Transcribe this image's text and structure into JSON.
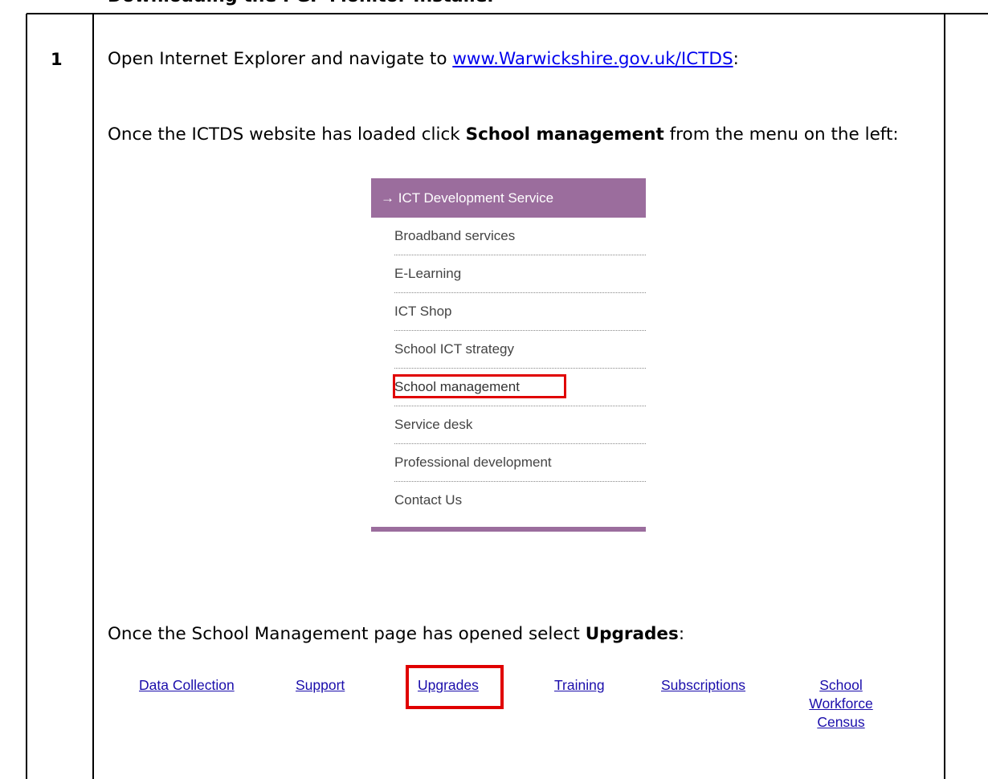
{
  "document": {
    "heading": "Downloading the PGP Monitor Installer",
    "step_number": "1",
    "line1_prefix": "Open Internet Explorer and navigate to ",
    "line1_link": "www.Warwickshire.gov.uk/ICTDS",
    "line1_suffix": ":",
    "para2_prefix": "Once the ICTDS website has loaded click ",
    "para2_bold": "School management",
    "para2_suffix": " from the menu on the left:",
    "para3_prefix": "Once the School Management page has opened select ",
    "para3_bold": "Upgrades",
    "para3_suffix": ":"
  },
  "menu": {
    "header": "→ ICT Development Service",
    "items": [
      "Broadband services",
      "E-Learning",
      "ICT Shop",
      "School ICT strategy",
      "School management",
      "Service desk",
      "Professional development",
      "Contact Us"
    ],
    "header_color": "#9b6d9d",
    "highlight_color": "#e00000"
  },
  "links": {
    "data_collection": "Data Collection",
    "support": "Support",
    "upgrades": "Upgrades",
    "training": "Training",
    "subscriptions": "Subscriptions",
    "school_workforce_census": [
      "School",
      "Workforce",
      "Census"
    ]
  }
}
